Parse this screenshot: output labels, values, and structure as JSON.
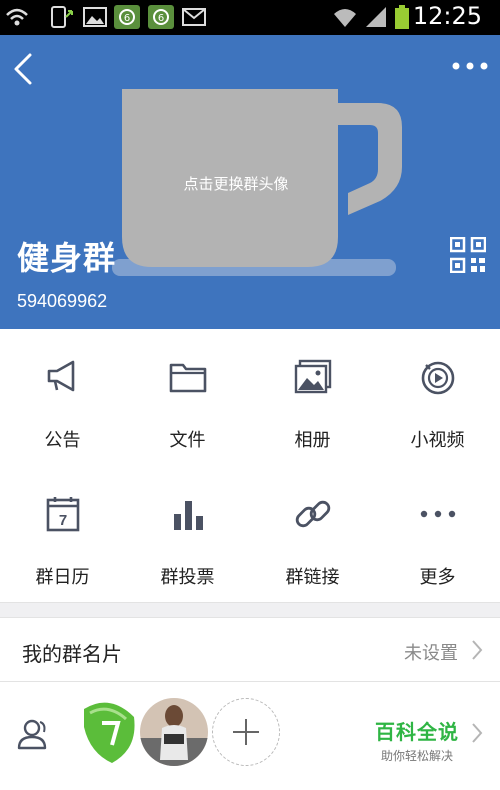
{
  "status_bar": {
    "time": "12:25",
    "icons": [
      "no-signal-icon",
      "phone-icon",
      "image-icon",
      "lock-icon",
      "lock-icon",
      "mail-icon",
      "wifi-icon",
      "signal-icon",
      "battery-icon"
    ]
  },
  "header": {
    "avatar_hint": "点击更换群头像",
    "group_name": "健身群",
    "group_id": "594069962",
    "background_color": "#3E74BE"
  },
  "grid": {
    "items": [
      {
        "label": "公告",
        "icon": "megaphone-icon"
      },
      {
        "label": "文件",
        "icon": "folder-icon"
      },
      {
        "label": "相册",
        "icon": "album-icon"
      },
      {
        "label": "小视频",
        "icon": "video-icon"
      },
      {
        "label": "群日历",
        "icon": "calendar-icon",
        "day": "7"
      },
      {
        "label": "群投票",
        "icon": "bar-chart-icon"
      },
      {
        "label": "群链接",
        "icon": "link-icon"
      },
      {
        "label": "更多",
        "icon": "more-dots-icon"
      }
    ]
  },
  "card_row": {
    "title": "我的群名片",
    "value": "未设置"
  },
  "members": {
    "watermark_title": "百科全说",
    "watermark_subtitle": "助你轻松解决"
  }
}
